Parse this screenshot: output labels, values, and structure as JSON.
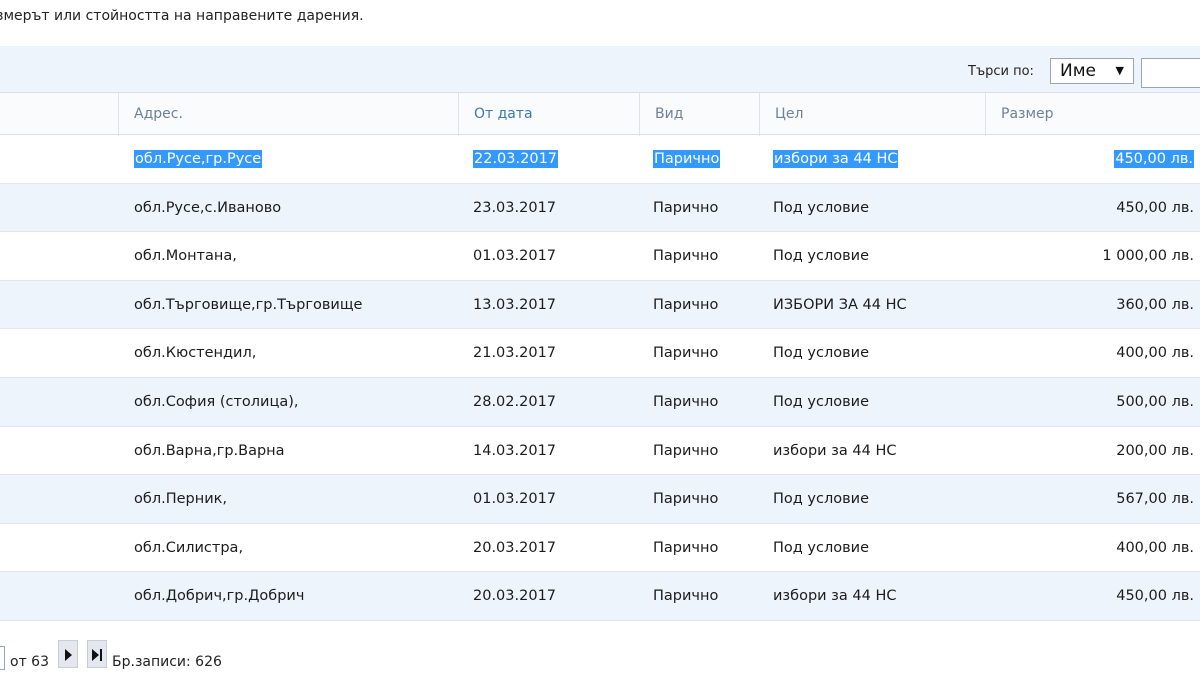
{
  "intro_text": "змерът или стойността на направените дарения.",
  "search": {
    "label": "Търси по:",
    "selected": "Име",
    "arrow": "▼",
    "input_value": ""
  },
  "table": {
    "headers": {
      "address": "Адрес.",
      "from_date": "От дата",
      "kind": "Вид",
      "goal": "Цел",
      "amount": "Размер"
    },
    "rows": [
      {
        "address": "обл.Русе,гр.Русе",
        "date": "22.03.2017",
        "kind": "Парично",
        "goal": "избори за 44 НС",
        "amount": "450,00 лв."
      },
      {
        "address": "обл.Русе,с.Иваново",
        "date": "23.03.2017",
        "kind": "Парично",
        "goal": "Под условие",
        "amount": "450,00 лв."
      },
      {
        "address": "обл.Монтана,",
        "date": "01.03.2017",
        "kind": "Парично",
        "goal": "Под условие",
        "amount": "1 000,00 лв."
      },
      {
        "address": "обл.Търговище,гр.Търговище",
        "date": "13.03.2017",
        "kind": "Парично",
        "goal": "ИЗБОРИ ЗА 44 НС",
        "amount": "360,00 лв."
      },
      {
        "address": "обл.Кюстендил,",
        "date": "21.03.2017",
        "kind": "Парично",
        "goal": "Под условие",
        "amount": "400,00 лв."
      },
      {
        "address": "обл.София (столица),",
        "date": "28.02.2017",
        "kind": "Парично",
        "goal": "Под условие",
        "amount": "500,00 лв."
      },
      {
        "address": "обл.Варна,гр.Варна",
        "date": "14.03.2017",
        "kind": "Парично",
        "goal": "избори за 44 НС",
        "amount": "200,00 лв."
      },
      {
        "address": "обл.Перник,",
        "date": "01.03.2017",
        "kind": "Парично",
        "goal": "Под условие",
        "amount": "567,00 лв."
      },
      {
        "address": "обл.Силистра,",
        "date": "20.03.2017",
        "kind": "Парично",
        "goal": "Под условие",
        "amount": "400,00 лв."
      },
      {
        "address": "обл.Добрич,гр.Добрич",
        "date": "20.03.2017",
        "kind": "Парично",
        "goal": "избори за 44 НС",
        "amount": "450,00 лв."
      }
    ]
  },
  "pager": {
    "of_label": "от 63",
    "records_label": "Бр.записи: 626"
  },
  "colors": {
    "selection": "#3399ff",
    "header_link": "#3a78b4",
    "row_alt": "#edf4fc"
  }
}
